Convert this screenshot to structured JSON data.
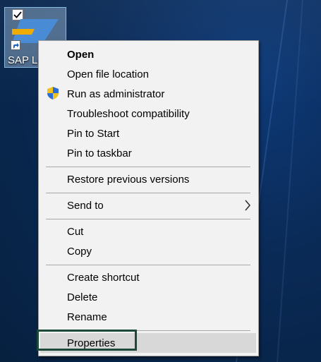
{
  "desktop": {
    "icon_label": "SAP Lo",
    "icon_checked": true,
    "icon_name": "sap-logon-icon"
  },
  "context_menu": {
    "items": [
      {
        "label": "Open",
        "bold": true
      },
      {
        "label": "Open file location"
      },
      {
        "label": "Run as administrator",
        "icon": "uac-shield-icon"
      },
      {
        "label": "Troubleshoot compatibility"
      },
      {
        "label": "Pin to Start"
      },
      {
        "label": "Pin to taskbar"
      },
      {
        "label": "Restore previous versions"
      },
      {
        "label": "Send to",
        "icon": "chevron-right-icon"
      },
      {
        "label": "Cut"
      },
      {
        "label": "Copy"
      },
      {
        "label": "Create shortcut"
      },
      {
        "label": "Delete"
      },
      {
        "label": "Rename"
      },
      {
        "label": "Properties",
        "highlighted": true
      }
    ]
  },
  "colors": {
    "desktop_bg": "#0a2a56",
    "menu_bg": "#f2f2f2",
    "highlight": "#d8d8d8",
    "focus_ring": "#1d4a38",
    "sap_yellow": "#f0ab00",
    "sap_blue": "#4a8bd6"
  }
}
